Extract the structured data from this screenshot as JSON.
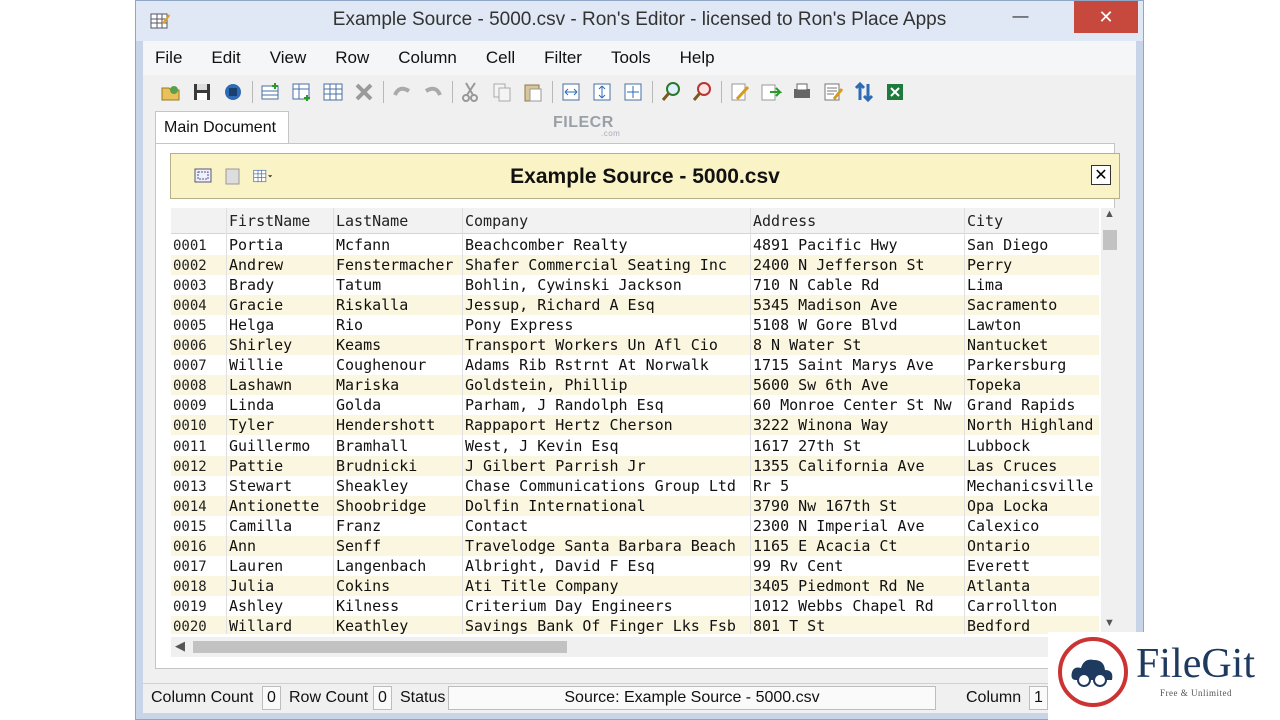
{
  "window": {
    "title": "Example Source - 5000.csv - Ron's Editor - licensed to Ron's Place Apps",
    "minimize_glyph": "—",
    "close_glyph": "✕"
  },
  "menu": [
    "File",
    "Edit",
    "View",
    "Row",
    "Column",
    "Cell",
    "Filter",
    "Tools",
    "Help"
  ],
  "toolbar": {
    "icons": [
      "open-icon",
      "save-icon",
      "save-all-icon",
      "insert-row-icon",
      "add-row-icon",
      "insert-column-icon",
      "delete-icon",
      "undo-icon",
      "redo-icon",
      "cut-icon",
      "copy-icon",
      "paste-icon",
      "fit-width-icon",
      "fit-rows-icon",
      "fit-all-icon",
      "zoom-in-icon",
      "zoom-out-icon",
      "edit-icon",
      "export-icon",
      "print-icon",
      "properties-icon",
      "sort-icon",
      "excel-icon"
    ]
  },
  "tabs": {
    "main": "Main Document"
  },
  "watermark_center": {
    "brand": "FILECR",
    "sub": ".com"
  },
  "document": {
    "title": "Example Source - 5000.csv",
    "close_glyph": "✕"
  },
  "grid": {
    "columns": [
      "FirstName",
      "LastName",
      "Company",
      "Address",
      "City"
    ],
    "rows": [
      [
        "0001",
        "Portia",
        "Mcfann",
        "Beachcomber Realty",
        "4891 Pacific Hwy",
        "San Diego"
      ],
      [
        "0002",
        "Andrew",
        "Fenstermacher",
        "Shafer Commercial Seating Inc",
        "2400 N Jefferson St",
        "Perry"
      ],
      [
        "0003",
        "Brady",
        "Tatum",
        "Bohlin, Cywinski Jackson",
        "710 N Cable Rd",
        "Lima"
      ],
      [
        "0004",
        "Gracie",
        "Riskalla",
        "Jessup, Richard A Esq",
        "5345 Madison Ave",
        "Sacramento"
      ],
      [
        "0005",
        "Helga",
        "Rio",
        "Pony Express",
        "5108 W Gore Blvd",
        "Lawton"
      ],
      [
        "0006",
        "Shirley",
        "Keams",
        "Transport Workers Un Afl Cio",
        "8 N Water St",
        "Nantucket"
      ],
      [
        "0007",
        "Willie",
        "Coughenour",
        "Adams Rib Rstrnt At Norwalk",
        "1715 Saint Marys Ave",
        "Parkersburg"
      ],
      [
        "0008",
        "Lashawn",
        "Mariska",
        "Goldstein, Phillip",
        "5600 Sw 6th Ave",
        "Topeka"
      ],
      [
        "0009",
        "Linda",
        "Golda",
        "Parham, J Randolph Esq",
        "60 Monroe Center St Nw",
        "Grand Rapids"
      ],
      [
        "0010",
        "Tyler",
        "Hendershott",
        "Rappaport Hertz Cherson",
        "3222 Winona Way",
        "North Highland"
      ],
      [
        "0011",
        "Guillermo",
        "Bramhall",
        "West, J Kevin Esq",
        "1617 27th St",
        "Lubbock"
      ],
      [
        "0012",
        "Pattie",
        "Brudnicki",
        "J Gilbert Parrish Jr",
        "1355 California Ave",
        "Las Cruces"
      ],
      [
        "0013",
        "Stewart",
        "Sheakley",
        "Chase Communications Group Ltd",
        "Rr 5",
        "Mechanicsville"
      ],
      [
        "0014",
        "Antionette",
        "Shoobridge",
        "Dolfin International",
        "3790 Nw 167th St",
        "Opa Locka"
      ],
      [
        "0015",
        "Camilla",
        "Franz",
        "Contact",
        "2300 N Imperial Ave",
        "Calexico"
      ],
      [
        "0016",
        "Ann",
        "Senff",
        "Travelodge Santa Barbara Beach",
        "1165 E Acacia Ct",
        "Ontario"
      ],
      [
        "0017",
        "Lauren",
        "Langenbach",
        "Albright, David F Esq",
        "99 Rv Cent",
        "Everett"
      ],
      [
        "0018",
        "Julia",
        "Cokins",
        "Ati Title Company",
        "3405 Piedmont Rd Ne",
        "Atlanta"
      ],
      [
        "0019",
        "Ashley",
        "Kilness",
        "Criterium Day Engineers",
        "1012 Webbs Chapel Rd",
        "Carrollton"
      ],
      [
        "0020",
        "Willard",
        "Keathley",
        "Savings Bank Of Finger Lks Fsb",
        "801 T St",
        "Bedford"
      ]
    ]
  },
  "status": {
    "column_count_label": "Column Count",
    "column_count_value": "0",
    "row_count_label": "Row Count",
    "row_count_value": "0",
    "status_label": "Status",
    "source": "Source: Example Source - 5000.csv",
    "column_label": "Column",
    "column_value": "1"
  },
  "watermark_corner": {
    "brand": "FileGit",
    "tagline": "Free & Unlimited"
  }
}
